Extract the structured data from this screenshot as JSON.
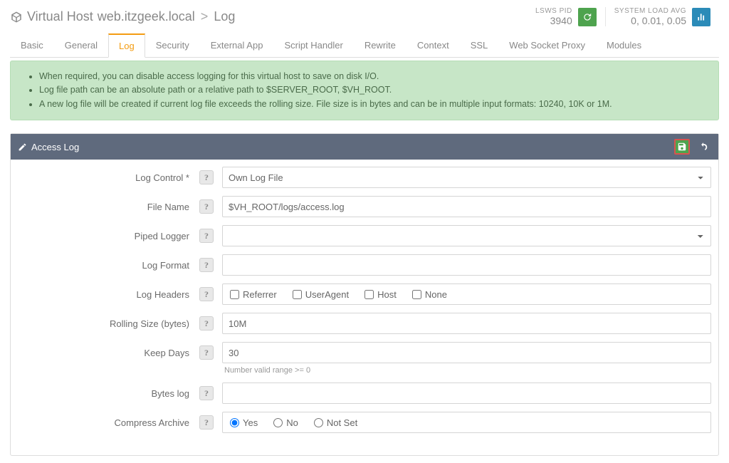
{
  "breadcrumb": {
    "prefix": "Virtual Host",
    "host": "web.itzgeek.local",
    "current": "Log"
  },
  "stats": {
    "pid": {
      "label": "LSWS PID",
      "value": "3940"
    },
    "load": {
      "label": "SYSTEM LOAD AVG",
      "value": "0, 0.01, 0.05"
    }
  },
  "tabs": [
    "Basic",
    "General",
    "Log",
    "Security",
    "External App",
    "Script Handler",
    "Rewrite",
    "Context",
    "SSL",
    "Web Socket Proxy",
    "Modules"
  ],
  "active_tab": "Log",
  "info": [
    "When required, you can disable access logging for this virtual host to save on disk I/O.",
    "Log file path can be an absolute path or a relative path to $SERVER_ROOT, $VH_ROOT.",
    "A new log file will be created if current log file exceeds the rolling size. File size is in bytes and can be in multiple input formats: 10240, 10K or 1M."
  ],
  "panel": {
    "title": "Access Log"
  },
  "form": {
    "log_control": {
      "label": "Log Control *",
      "value": "Own Log File"
    },
    "file_name": {
      "label": "File Name",
      "value": "$VH_ROOT/logs/access.log"
    },
    "piped_logger": {
      "label": "Piped Logger",
      "value": ""
    },
    "log_format": {
      "label": "Log Format",
      "value": ""
    },
    "log_headers": {
      "label": "Log Headers",
      "opts": [
        "Referrer",
        "UserAgent",
        "Host",
        "None"
      ]
    },
    "rolling_size": {
      "label": "Rolling Size (bytes)",
      "value": "10M"
    },
    "keep_days": {
      "label": "Keep Days",
      "value": "30",
      "hint": "Number valid range >= 0"
    },
    "bytes_log": {
      "label": "Bytes log",
      "value": ""
    },
    "compress": {
      "label": "Compress Archive",
      "opts": [
        "Yes",
        "No",
        "Not Set"
      ],
      "checked": "Yes"
    }
  }
}
